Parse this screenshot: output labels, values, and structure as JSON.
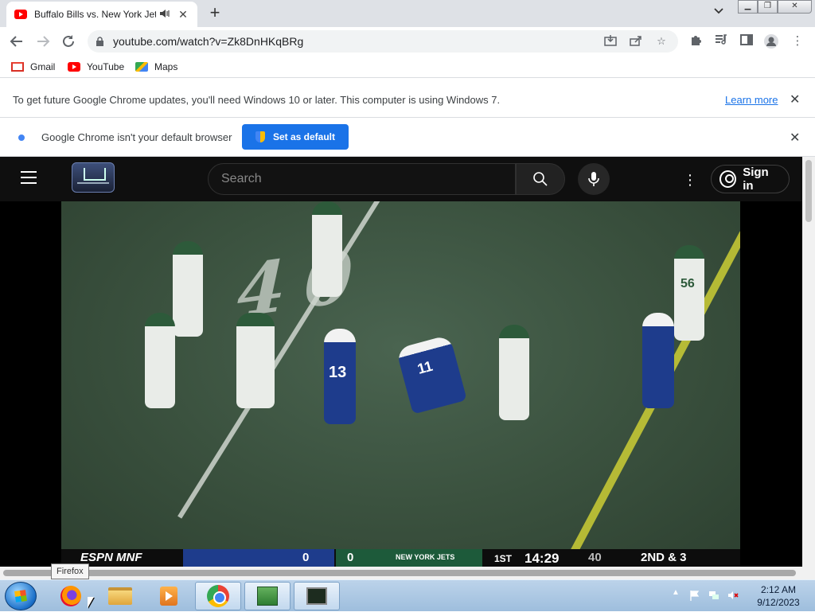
{
  "browser": {
    "tab_title": "Buffalo Bills vs. New York Jets",
    "url": "youtube.com/watch?v=Zk8DnHKqBRg"
  },
  "bookmarks": [
    "Gmail",
    "YouTube",
    "Maps"
  ],
  "update_bar": {
    "message": "To get future Google Chrome updates, you'll need Windows 10 or later. This computer is using Windows 7.",
    "link": "Learn more"
  },
  "default_bar": {
    "message": "Google Chrome isn't your default browser",
    "button": "Set as default"
  },
  "youtube": {
    "search_placeholder": "Search",
    "sign_in": "Sign in"
  },
  "video": {
    "field_number": "40",
    "network": "ESPN MNF",
    "bills_score": "0",
    "jets_score": "0",
    "jets_label": "NEW YORK JETS",
    "quarter": "1ST",
    "clock": "14:29",
    "play_clock": "40",
    "down": "2ND & 3",
    "bills_numbers": [
      "13",
      "11"
    ],
    "jets_numbers": [
      "56"
    ]
  },
  "tooltip": "Firefox",
  "taskbar": {
    "time": "2:12 AM",
    "date": "9/12/2023"
  },
  "icons": {
    "tab_audio": "speaker-icon",
    "tab_close": "close-icon",
    "new_tab": "plus-icon",
    "back": "arrow-left-icon",
    "forward": "arrow-right-icon",
    "reload": "reload-icon",
    "lock": "lock-icon",
    "install": "install-icon",
    "share": "share-icon",
    "bookmark": "star-icon",
    "extensions": "puzzle-icon",
    "media": "media-control-icon",
    "sidepanel": "side-panel-icon",
    "profile": "profile-icon",
    "menu": "kebab-icon"
  }
}
